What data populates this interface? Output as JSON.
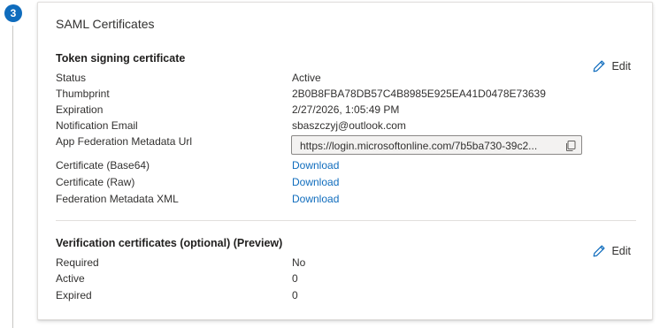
{
  "step": {
    "number": "3"
  },
  "card": {
    "title": "SAML Certificates"
  },
  "token_signing": {
    "title": "Token signing certificate",
    "edit_label": "Edit",
    "rows": [
      {
        "label": "Status",
        "value": "Active"
      },
      {
        "label": "Thumbprint",
        "value": "2B0B8FBA78DB57C4B8985E925EA41D0478E73639"
      },
      {
        "label": "Expiration",
        "value": "2/27/2026, 1:05:49 PM"
      },
      {
        "label": "Notification Email",
        "value": "sbaszczyj@outlook.com"
      },
      {
        "label": "App Federation Metadata Url",
        "value": "https://login.microsoftonline.com/7b5ba730-39c2..."
      },
      {
        "label": "Certificate (Base64)",
        "value": "Download"
      },
      {
        "label": "Certificate (Raw)",
        "value": "Download"
      },
      {
        "label": "Federation Metadata XML",
        "value": "Download"
      }
    ]
  },
  "verification": {
    "title": "Verification certificates (optional) (Preview)",
    "edit_label": "Edit",
    "rows": [
      {
        "label": "Required",
        "value": "No"
      },
      {
        "label": "Active",
        "value": "0"
      },
      {
        "label": "Expired",
        "value": "0"
      }
    ]
  },
  "icons": {
    "edit": "pencil-icon",
    "copy": "copy-icon"
  },
  "colors": {
    "accent": "#0f6cbd",
    "badge": "#0f6cbd",
    "link": "#0f6cbd"
  }
}
